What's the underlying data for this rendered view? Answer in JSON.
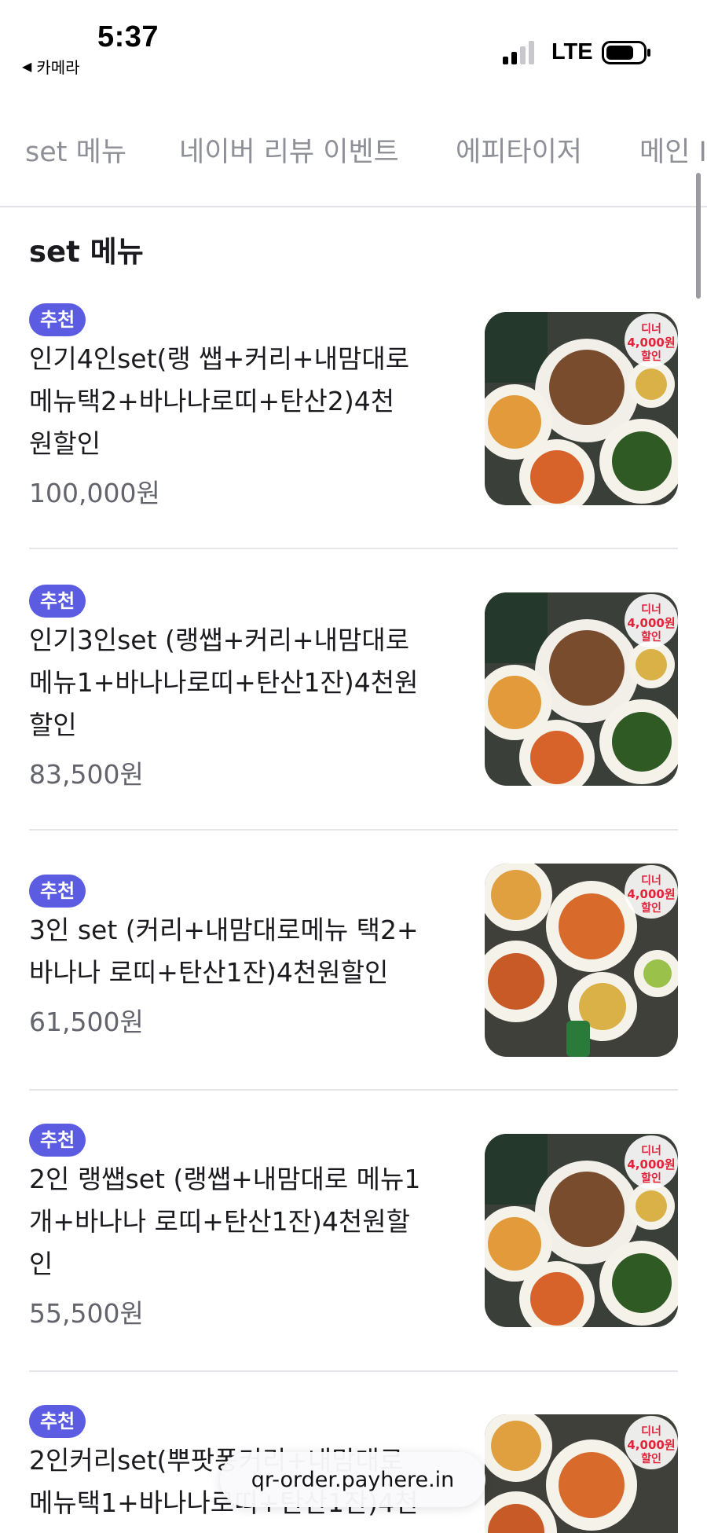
{
  "status_bar": {
    "time": "5:37",
    "back_label": "카메라",
    "network": "LTE"
  },
  "tabs": [
    {
      "label": "set 메뉴",
      "selected": true
    },
    {
      "label": "네이버 리뷰 이벤트",
      "selected": false
    },
    {
      "label": "에피타이저",
      "selected": false
    },
    {
      "label": "메인 I",
      "selected": false
    }
  ],
  "section": {
    "title": "set 메뉴"
  },
  "items": [
    {
      "badge": "추천",
      "name_lines": [
        "인기4인set(랭 쌥+커리+내맘대로",
        "메뉴택2+바나나로띠+탄산2)4천",
        "원할인"
      ],
      "price": "100,000원",
      "image_tag": {
        "line1": "디너",
        "line2": "4,000원",
        "line3": "할인"
      }
    },
    {
      "badge": "추천",
      "name_lines": [
        "인기3인set (랭쌥+커리+내맘대로",
        "메뉴1+바나나로띠+탄산1잔)4천원",
        "할인"
      ],
      "price": "83,500원",
      "image_tag": {
        "line1": "디너",
        "line2": "4,000원",
        "line3": "할인"
      }
    },
    {
      "badge": "추천",
      "name_lines": [
        "3인 set (커리+내맘대로메뉴 택2+",
        "바나나 로띠+탄산1잔)4천원할인"
      ],
      "price": "61,500원",
      "image_tag": {
        "line1": "디너",
        "line2": "4,000원",
        "line3": "할인"
      }
    },
    {
      "badge": "추천",
      "name_lines": [
        "2인 랭쌥set (랭쌥+내맘대로 메뉴1",
        "개+바나나 로띠+탄산1잔)4천원할",
        "인"
      ],
      "price": "55,500원",
      "image_tag": {
        "line1": "디너",
        "line2": "4,000원",
        "line3": "할인"
      }
    },
    {
      "badge": "추천",
      "name_lines": [
        "2인커리set(뿌팟퐁커리+내맘대로",
        "메뉴택1+바나나로띠+탄산1잔)4천"
      ],
      "price": "",
      "image_tag": {
        "line1": "디너",
        "line2": "4,000원",
        "line3": "할인"
      }
    }
  ],
  "url_bar": {
    "text": "qr-order.payhere.in"
  },
  "colors": {
    "badge": "#5b5ce2",
    "price": "#63646c",
    "tab_inactive": "#8e8f97",
    "tag_red": "#e0243a"
  }
}
